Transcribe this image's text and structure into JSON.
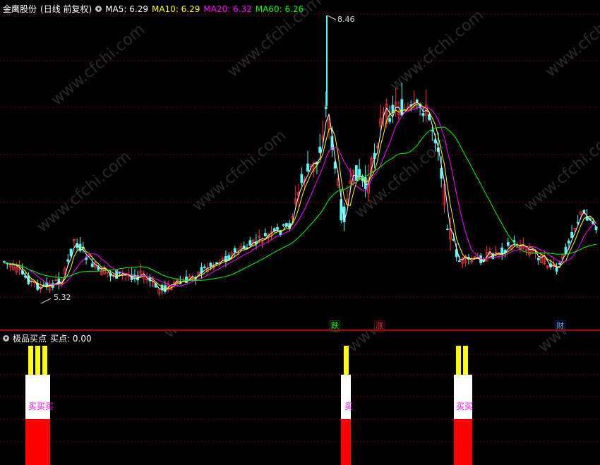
{
  "main": {
    "title": "金鹰股份",
    "period": "(日线 前复权)",
    "ma": [
      {
        "label": "MA5: 6.29",
        "color": "#ffffff"
      },
      {
        "label": "MA10: 6.29",
        "color": "#ffff00"
      },
      {
        "label": "MA20: 6.32",
        "color": "#ff00ff"
      },
      {
        "label": "MA60: 6.26",
        "color": "#00ff00"
      }
    ],
    "high_label": "8.46",
    "low_label": "5.32",
    "tags": [
      {
        "text": "跌",
        "color": "#00ff00"
      },
      {
        "text": "涨",
        "color": "#ff3333"
      },
      {
        "text": "财",
        "color": "#66aaff"
      }
    ]
  },
  "sub": {
    "title": "极品买点",
    "value": "买点: 0.00",
    "signals": [
      {
        "label": "买买买"
      },
      {
        "label": "买"
      },
      {
        "label": "买买"
      }
    ]
  },
  "watermark": "www.cfchi.com",
  "colors": {
    "up": "#ff3232",
    "down": "#54ffff",
    "grid": "#7a0000"
  }
}
